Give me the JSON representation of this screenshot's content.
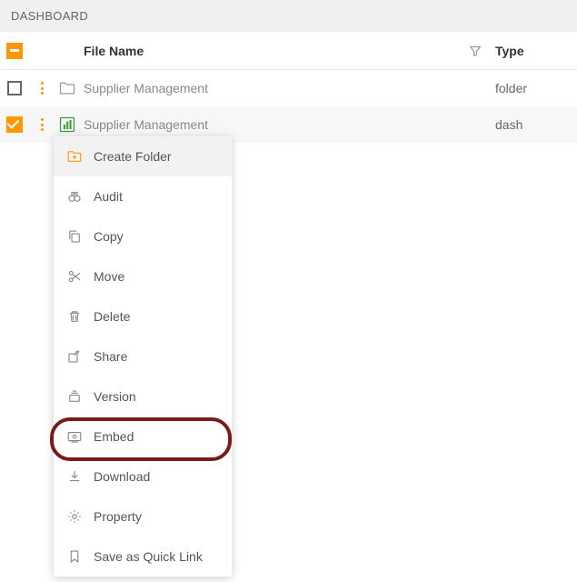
{
  "breadcrumb": "DASHBOARD",
  "header": {
    "name": "File Name",
    "type": "Type"
  },
  "rows": [
    {
      "name": "Supplier Management",
      "type": "folder",
      "checked": false,
      "icon": "folder"
    },
    {
      "name": "Supplier Management",
      "type": "dash",
      "checked": true,
      "icon": "dash"
    }
  ],
  "menu": [
    {
      "id": "create-folder",
      "label": "Create Folder",
      "icon": "folder-plus",
      "orange": true,
      "hover": true
    },
    {
      "id": "audit",
      "label": "Audit",
      "icon": "binoculars"
    },
    {
      "id": "copy",
      "label": "Copy",
      "icon": "copy"
    },
    {
      "id": "move",
      "label": "Move",
      "icon": "scissors"
    },
    {
      "id": "delete",
      "label": "Delete",
      "icon": "trash"
    },
    {
      "id": "share",
      "label": "Share",
      "icon": "share"
    },
    {
      "id": "version",
      "label": "Version",
      "icon": "stack"
    },
    {
      "id": "embed",
      "label": "Embed",
      "icon": "embed",
      "highlighted": true
    },
    {
      "id": "download",
      "label": "Download",
      "icon": "download"
    },
    {
      "id": "property",
      "label": "Property",
      "icon": "gear"
    },
    {
      "id": "quicklink",
      "label": "Save as Quick Link",
      "icon": "bookmark"
    }
  ]
}
